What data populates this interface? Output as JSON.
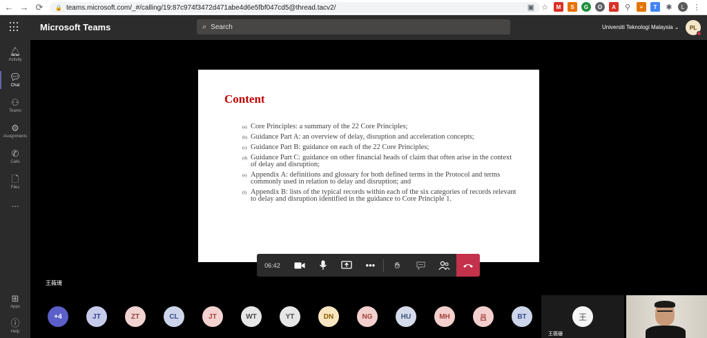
{
  "browser": {
    "back": "←",
    "forward": "→",
    "reload": "⟳",
    "url": "teams.microsoft.com/_#/calling/19:87c974f3472d471abe4d6e5fbf047cd5@thread.tacv2/"
  },
  "header": {
    "app_name": "Microsoft Teams",
    "search_placeholder": "Search",
    "org_name": "Universiti Teknologi Malaysia",
    "user_initials": "PL"
  },
  "rail": [
    {
      "label": "Activity",
      "icon": "bell-icon"
    },
    {
      "label": "Chat",
      "icon": "chat-icon"
    },
    {
      "label": "Teams",
      "icon": "teams-icon"
    },
    {
      "label": "Assignments",
      "icon": "assignments-icon"
    },
    {
      "label": "Calls",
      "icon": "phone-icon"
    },
    {
      "label": "Files",
      "icon": "file-icon"
    },
    {
      "label": "...",
      "icon": "more-icon"
    },
    {
      "label": "Apps",
      "icon": "apps-icon"
    },
    {
      "label": "Help",
      "icon": "help-icon"
    }
  ],
  "slide": {
    "title": "Content",
    "items": [
      {
        "marker": "(a)",
        "text": "Core Principles: a summary of the 22 Core Principles;"
      },
      {
        "marker": "(b)",
        "text": "Guidance Part A: an overview of delay, disruption and acceleration concepts;"
      },
      {
        "marker": "(c)",
        "text": "Guidance Part B: guidance on each of the 22 Core Principles;"
      },
      {
        "marker": "(d)",
        "text": "Guidance Part C: guidance on other financial heads of claim that often arise in the context of delay and disruption;"
      },
      {
        "marker": "(e)",
        "text": "Appendix A: definitions and glossary for both defined terms in the Protocol and terms commonly used in relation to delay and disruption; and"
      },
      {
        "marker": "(f)",
        "text": "Appendix B: lists of the typical records within each of the six categories of records relevant to delay and disruption identified in the guidance to Core Principle 1."
      }
    ]
  },
  "speaker_label": "王薇珊",
  "controls": {
    "timer": "06:42"
  },
  "participants": [
    {
      "initials": "+4",
      "bg": "#5b5fc7",
      "fg": "#ffffff"
    },
    {
      "initials": "JT",
      "bg": "#c5cbe9",
      "fg": "#33419a"
    },
    {
      "initials": "ZT",
      "bg": "#f1d3d1",
      "fg": "#9a3f3a"
    },
    {
      "initials": "CL",
      "bg": "#cdd5ea",
      "fg": "#3a4d8a"
    },
    {
      "initials": "JT",
      "bg": "#f3d2cf",
      "fg": "#a5443c"
    },
    {
      "initials": "WT",
      "bg": "#e6e6e6",
      "fg": "#4a4a4a"
    },
    {
      "initials": "YT",
      "bg": "#e6e6e6",
      "fg": "#4a4a4a"
    },
    {
      "initials": "DN",
      "bg": "#f8e6c0",
      "fg": "#8a5a00"
    },
    {
      "initials": "NG",
      "bg": "#f3d0cd",
      "fg": "#a4403a"
    },
    {
      "initials": "HU",
      "bg": "#d5dbea",
      "fg": "#3d4e7a"
    },
    {
      "initials": "MH",
      "bg": "#f3d0cd",
      "fg": "#a4403a"
    },
    {
      "initials": "吕",
      "bg": "#f3d0cd",
      "fg": "#a4403a"
    },
    {
      "initials": "BT",
      "bg": "#cdd5ea",
      "fg": "#3a4d8a"
    }
  ],
  "self_tile": {
    "initial": "王",
    "label": "王薇珊"
  }
}
